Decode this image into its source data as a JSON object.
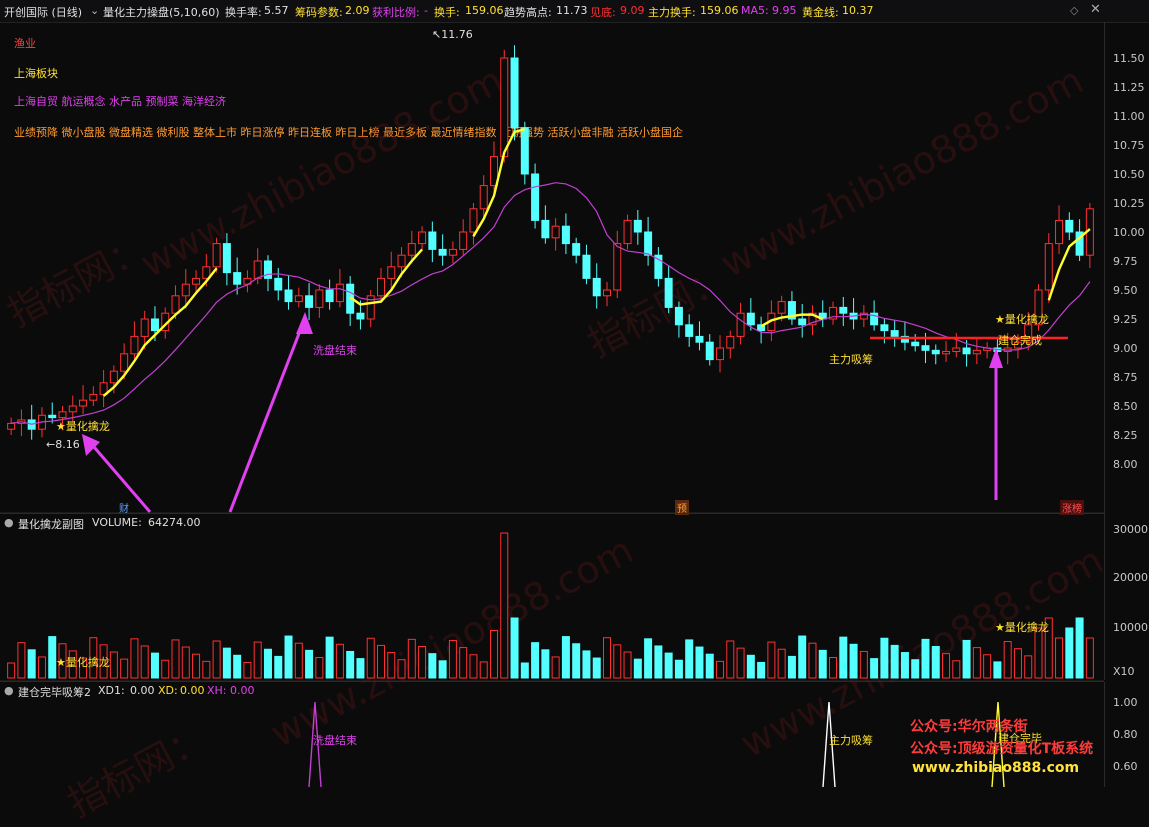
{
  "header": {
    "stock": "开创国际 (日线)",
    "indicator": "量化主力操盘(5,10,60)",
    "turnover_label": "换手率:",
    "turnover_value": "5.57",
    "chip_label": "筹码参数:",
    "chip_value": "2.09",
    "profit_label": "获利比例:",
    "profit_value": "-",
    "huanshou_label": "换手:",
    "huanshou_value": "159.06",
    "trend_label": "趋势高点:",
    "trend_value": "11.73",
    "bottom_label": "见底:",
    "bottom_value": "9.09",
    "main_turn_label": "主力换手:",
    "main_turn_value": "159.06",
    "ma5_label": "MA5:",
    "ma5_value": "9.95",
    "gold_label": "黄金线:",
    "gold_value": "10.37"
  },
  "tags": {
    "industry": "渔业",
    "region": "上海板块",
    "concepts": "上海自贸  航运概念  水产品  预制菜  海洋经济",
    "styles": "业绩预降  微小盘股  微盘精选  微利股  整体上市  昨日涨停  昨日连板  昨日上榜  最近多板  最近情绪指数  近期强势  活跃小盘非融  活跃小盘国企"
  },
  "main_axis": [
    "11.50",
    "11.25",
    "11.00",
    "10.75",
    "10.50",
    "10.25",
    "10.00",
    "9.75",
    "9.50",
    "9.25",
    "9.00",
    "8.75",
    "8.50",
    "8.25",
    "8.00"
  ],
  "annotations": {
    "high_marker": "11.76",
    "low_marker": "8.16",
    "qinlong_1": "量化擒龙",
    "wash_end": "洗盘结束",
    "absorb": "主力吸筹",
    "qinlong_2": "量化擒龙",
    "build_done": "建仓完成",
    "badge_cai": "财",
    "badge_yu": "预",
    "badge_zhang": "涨榜"
  },
  "volume_pane": {
    "title": "量化擒龙副图",
    "vol_label": "VOLUME:",
    "vol_value": "64274.00",
    "axis": [
      "30000",
      "20000",
      "10000"
    ],
    "unit": "X10",
    "qinlong_1": "量化擒龙",
    "qinlong_2": "量化擒龙"
  },
  "signal_pane": {
    "title": "建仓完毕吸筹2",
    "xd1_label": "XD1:",
    "xd1_value": "0.00",
    "xd_label": "XD:",
    "xd_value": "0.00",
    "xh_label": "XH:",
    "xh_value": "0.00",
    "axis": [
      "1.00",
      "0.80",
      "0.60"
    ],
    "wash_end": "洗盘结束",
    "absorb": "主力吸筹",
    "build_done": "建仓完毕"
  },
  "watermark": {
    "text_a": "指标网：",
    "text_b": "www.zhibiao888.com",
    "promo_1": "公众号:华尔两条街",
    "promo_2": "公众号:顶级游资量化T板系统",
    "promo_3": "www.zhibiao888.com"
  },
  "colors": {
    "up": "#ff3030",
    "down": "#54ffff",
    "ma_purple": "#c040d0",
    "gold_line": "#ffff30",
    "arrow": "#e040f0"
  }
}
